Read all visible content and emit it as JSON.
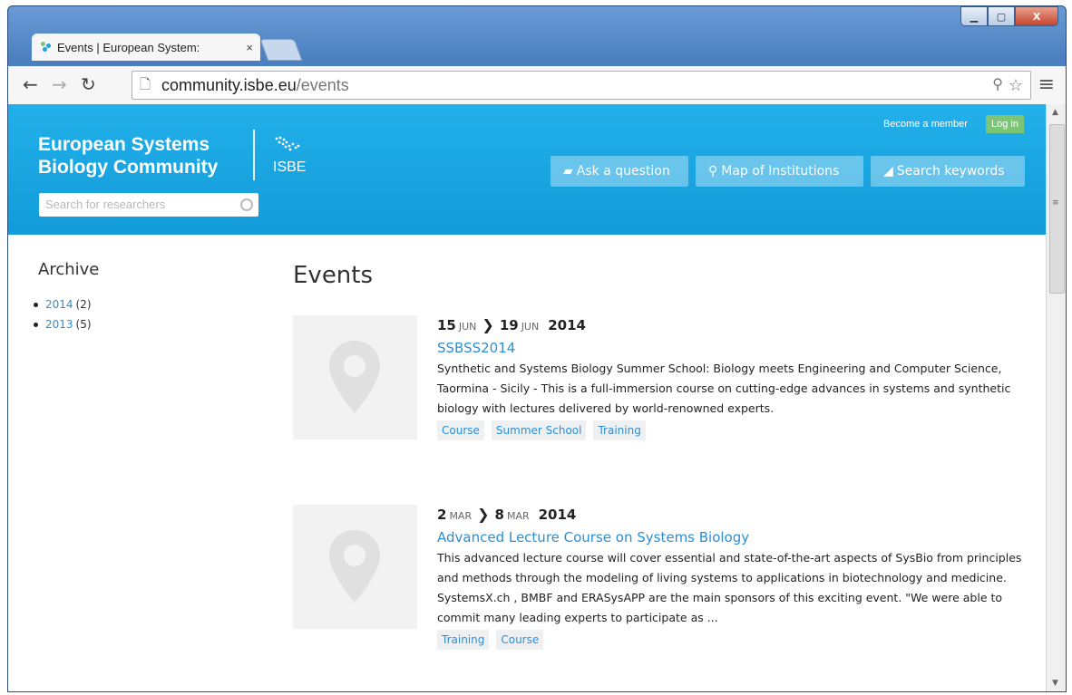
{
  "browser": {
    "tab_title": "Events | European System:",
    "tab_close": "×",
    "url_host": "community.isbe.eu",
    "url_path": "/events",
    "window_buttons": {
      "minimize": "▁",
      "maximize": "▢",
      "close": "X"
    }
  },
  "header": {
    "logo_line1": "European Systems",
    "logo_line2": "Biology Community",
    "isbe_logo": "ISBE",
    "search_placeholder": "Search for researchers",
    "become_member": "Become a member",
    "login": "Log in",
    "buttons": [
      {
        "label": "Ask a question",
        "icon": "chat-icon"
      },
      {
        "label": "Map of Institutions",
        "icon": "map-pin-icon"
      },
      {
        "label": "Search keywords",
        "icon": "tag-icon"
      }
    ]
  },
  "sidebar": {
    "title": "Archive",
    "items": [
      {
        "year": "2014",
        "count": "(2)"
      },
      {
        "year": "2013",
        "count": "(5)"
      }
    ]
  },
  "main": {
    "title": "Events",
    "events": [
      {
        "start_day": "15",
        "start_month": "JUN",
        "end_day": "19",
        "end_month": "JUN",
        "year": "2014",
        "title": "SSBSS2014",
        "description": "Synthetic and Systems Biology Summer School: Biology meets Engineering and Computer Science, Taormina - Sicily - This is a full-immersion course on cutting-edge advances in systems and synthetic biology with lectures delivered by world-renowned experts.",
        "tags": [
          "Course",
          "Summer School",
          "Training"
        ]
      },
      {
        "start_day": "2",
        "start_month": "MAR",
        "end_day": "8",
        "end_month": "MAR",
        "year": "2014",
        "title": "Advanced Lecture Course on Systems Biology",
        "description": "This advanced lecture course will cover essential and state-of-the-art aspects of SysBio from principles and methods through the modeling of living systems to applications in biotechnology and medicine. SystemsX.ch , BMBF and ERASysAPP are the main sponsors of this exciting event. \"We were able to commit many leading experts to participate as ...",
        "tags": [
          "Training",
          "Course"
        ]
      }
    ]
  },
  "colors": {
    "header_blue": "#1aa3e0",
    "link_blue": "#2c8fd6",
    "login_green": "#7cc576"
  }
}
